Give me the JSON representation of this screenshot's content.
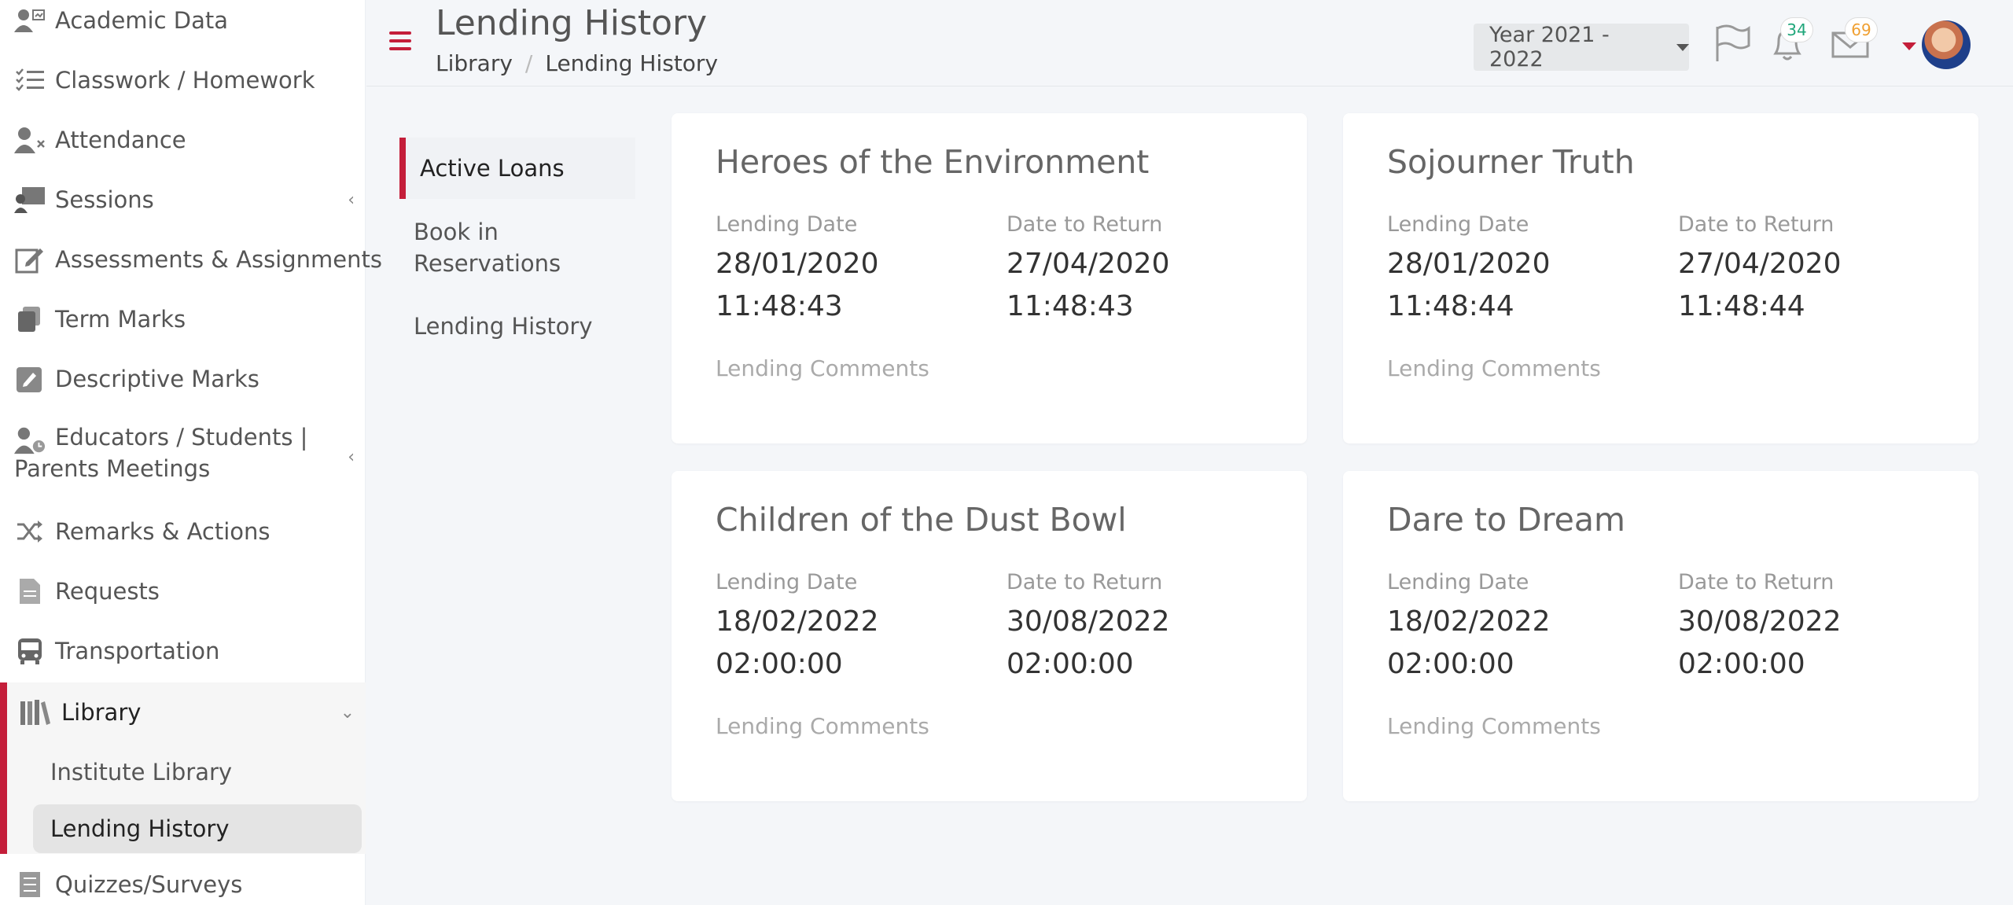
{
  "sidebar": {
    "items": [
      {
        "label": "Academic Data",
        "icon": "academic-data-icon"
      },
      {
        "label": "Classwork / Homework",
        "icon": "checklist-icon"
      },
      {
        "label": "Attendance",
        "icon": "user-x-icon"
      },
      {
        "label": "Sessions",
        "icon": "presentation-icon"
      },
      {
        "label": "Assessments & Assignments",
        "icon": "edit-icon"
      },
      {
        "label": "Term Marks",
        "icon": "copy-icon"
      },
      {
        "label": "Descriptive Marks",
        "icon": "pencil-note-icon"
      },
      {
        "label": "Educators / Students | Parents Meetings",
        "label_line1": "Educators / Students |",
        "label_line2": "Parents Meetings",
        "icon": "user-clock-icon"
      },
      {
        "label": "Remarks & Actions",
        "icon": "shuffle-icon"
      },
      {
        "label": "Requests",
        "icon": "document-icon"
      },
      {
        "label": "Transportation",
        "icon": "bus-icon"
      },
      {
        "label": "Library",
        "icon": "books-icon"
      },
      {
        "label": "Quizzes/Surveys",
        "icon": "quiz-list-icon"
      }
    ],
    "library_sub": [
      {
        "label": "Institute Library"
      },
      {
        "label": "Lending History"
      }
    ]
  },
  "header": {
    "title": "Lending History",
    "breadcrumb": [
      "Library",
      "Lending History"
    ],
    "year_select": "Year 2021 - 2022",
    "notifications_count": "34",
    "messages_count": "69"
  },
  "tabs": [
    {
      "label": "Active Loans"
    },
    {
      "label": "Book in Reservations",
      "line1": "Book in",
      "line2": "Reservations"
    },
    {
      "label": "Lending History"
    }
  ],
  "labels": {
    "lending_date": "Lending Date",
    "date_to_return": "Date to Return",
    "lending_comments": "Lending Comments"
  },
  "loans": [
    {
      "title": "Heroes of the Environment",
      "lending_date": "28/01/2020",
      "lending_time": "11:48:43",
      "return_date": "27/04/2020",
      "return_time": "11:48:43"
    },
    {
      "title": "Sojourner Truth",
      "lending_date": "28/01/2020",
      "lending_time": "11:48:44",
      "return_date": "27/04/2020",
      "return_time": "11:48:44"
    },
    {
      "title": "Children of the Dust Bowl",
      "lending_date": "18/02/2022",
      "lending_time": "02:00:00",
      "return_date": "30/08/2022",
      "return_time": "02:00:00"
    },
    {
      "title": "Dare to Dream",
      "lending_date": "18/02/2022",
      "lending_time": "02:00:00",
      "return_date": "30/08/2022",
      "return_time": "02:00:00"
    }
  ],
  "colors": {
    "accent": "#c41e3a",
    "badge_green": "#1fa67a",
    "badge_orange": "#f0a032"
  }
}
